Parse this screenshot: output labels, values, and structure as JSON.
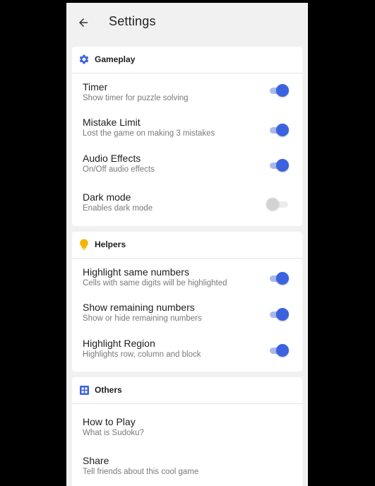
{
  "appbar": {
    "title": "Settings",
    "back_icon": "arrow-left-icon"
  },
  "colors": {
    "accent": "#3b63e0",
    "helpers_bulb": "#f5b400",
    "background": "#f1f1f1"
  },
  "gameplay": {
    "header": "Gameplay",
    "icon": "gear-icon",
    "items": [
      {
        "title": "Timer",
        "subtitle": "Show timer for puzzle solving",
        "enabled": true
      },
      {
        "title": "Mistake Limit",
        "subtitle": "Lost the game on making 3 mistakes",
        "enabled": true
      },
      {
        "title": "Audio Effects",
        "subtitle": "On/Off audio effects",
        "enabled": true
      },
      {
        "title": "Dark mode",
        "subtitle": "Enables dark mode",
        "enabled": false
      }
    ]
  },
  "helpers": {
    "header": "Helpers",
    "icon": "lightbulb-icon",
    "items": [
      {
        "title": "Highlight same numbers",
        "subtitle": "Cells with same digits will be highlighted",
        "enabled": true
      },
      {
        "title": "Show remaining numbers",
        "subtitle": "Show or hide remaining numbers",
        "enabled": true
      },
      {
        "title": "Highlight Region",
        "subtitle": "Highlights row, column and block",
        "enabled": true
      }
    ]
  },
  "others": {
    "header": "Others",
    "icon": "apps-grid-icon",
    "items": [
      {
        "title": "How to Play",
        "subtitle": "What is Sudoku?"
      },
      {
        "title": "Share",
        "subtitle": "Tell friends about this cool game"
      }
    ]
  }
}
